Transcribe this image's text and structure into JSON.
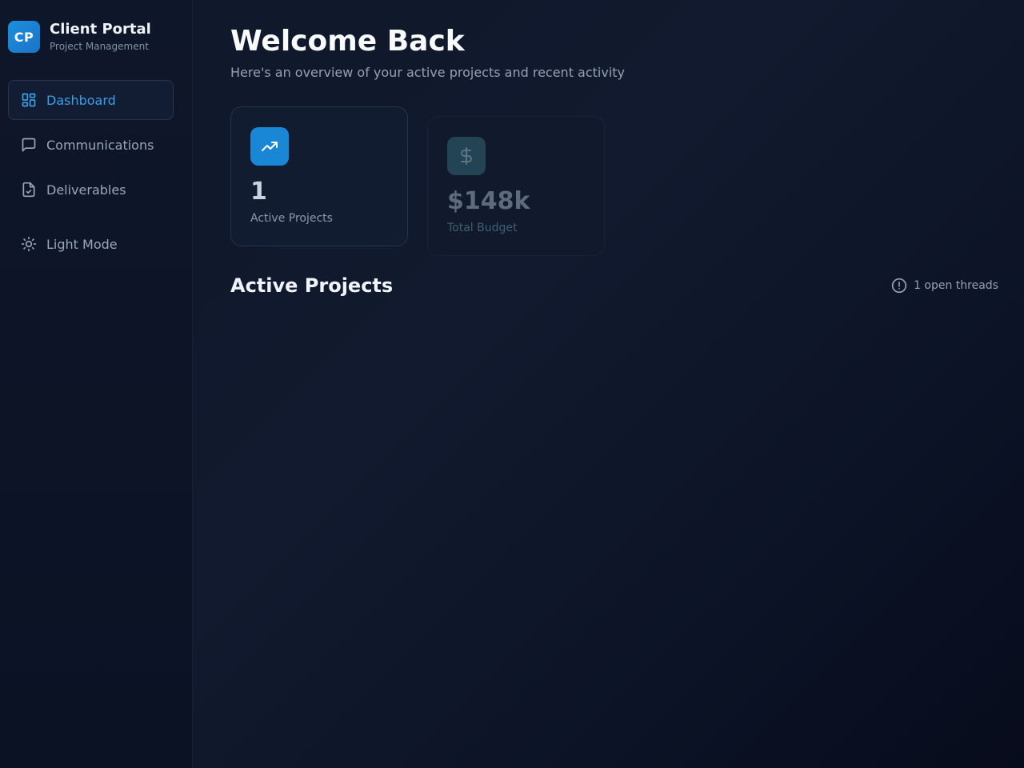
{
  "brand": {
    "logo_text": "CP",
    "title": "Client Portal",
    "subtitle": "Project Management"
  },
  "nav": {
    "items": [
      {
        "label": "Dashboard",
        "icon": "dashboard-grid-icon",
        "active": true
      },
      {
        "label": "Communications",
        "icon": "message-square-icon",
        "active": false
      },
      {
        "label": "Deliverables",
        "icon": "file-check-icon",
        "active": false
      }
    ],
    "theme_toggle": {
      "label": "Light Mode",
      "icon": "sun-icon"
    }
  },
  "header": {
    "title": "Welcome Back",
    "subtitle": "Here's an overview of your active projects and recent activity"
  },
  "stats": [
    {
      "value": "1",
      "label": "Active Projects",
      "icon": "trending-up-icon"
    },
    {
      "value": "$148k",
      "label": "Total Budget",
      "icon": "dollar-icon"
    }
  ],
  "projects_section": {
    "title": "Active Projects",
    "threads_label": "1 open threads",
    "threads_icon": "alert-circle-icon"
  },
  "colors": {
    "accent": "#1a86d6",
    "active_nav_text": "#3b9fe6",
    "background": "#0f172a"
  }
}
